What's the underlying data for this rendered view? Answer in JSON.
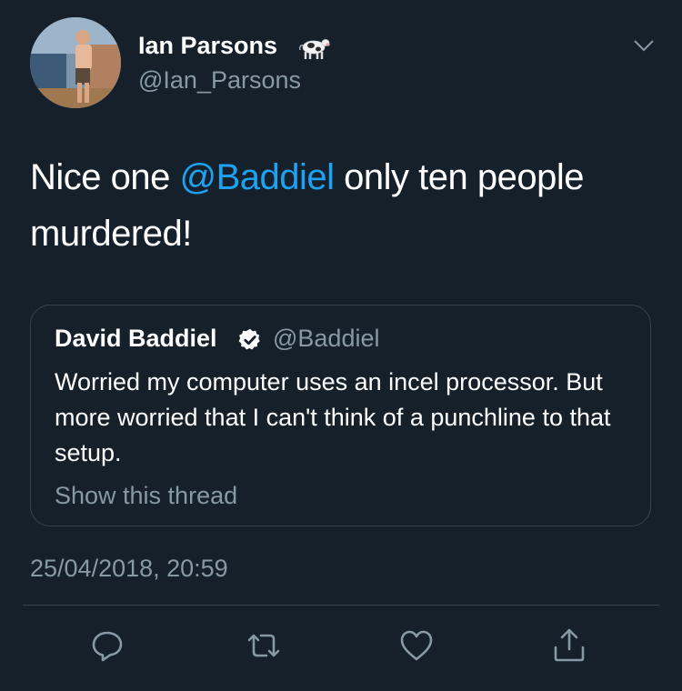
{
  "tweet": {
    "display_name": "Ian Parsons",
    "display_emoji": "cow-icon",
    "handle": "@Ian_Parsons",
    "text_before": "Nice one ",
    "mention": "@Baddiel",
    "text_after": " only ten people murdered!",
    "timestamp": "25/04/2018, 20:59"
  },
  "quote": {
    "author": "David Baddiel",
    "handle": "@Baddiel",
    "text": "Worried my computer uses an incel processor. But more worried that I can't think of a punchline to that setup.",
    "show_thread": "Show this thread"
  },
  "actions": [
    "reply-icon",
    "retweet-icon",
    "like-icon",
    "share-icon"
  ],
  "colors": {
    "background": "#15202b",
    "text": "#ffffff",
    "muted": "#8899a6",
    "accent": "#1da1f2",
    "border": "#38444d"
  }
}
